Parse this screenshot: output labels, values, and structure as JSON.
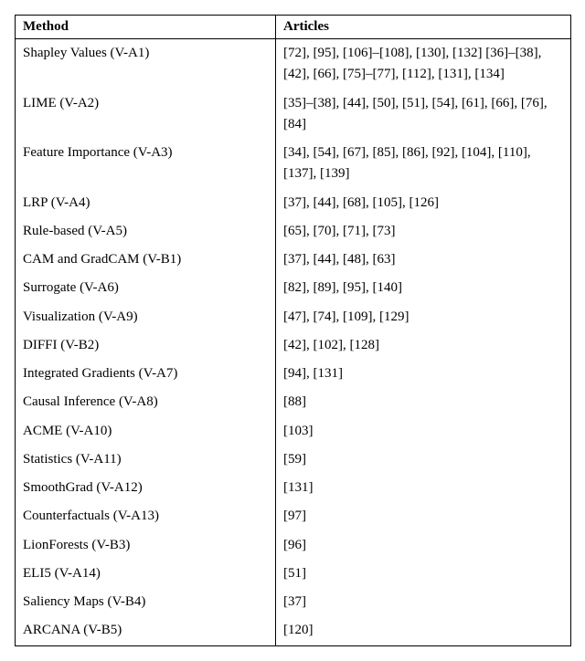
{
  "headers": {
    "method": "Method",
    "articles": "Articles"
  },
  "rows": [
    {
      "method": "Shapley Values (V-A1)",
      "articles": " [72], [95], [106]–[108], [130], [132] [36]–[38], [42], [66], [75]–[77], [112], [131], [134]"
    },
    {
      "method": "LIME (V-A2)",
      "articles": " [35]–[38], [44], [50], [51], [54], [61], [66], [76], [84]"
    },
    {
      "method": "Feature Importance (V-A3)",
      "articles": " [34], [54], [67], [85], [86], [92], [104], [110], [137], [139]"
    },
    {
      "method": "LRP (V-A4)",
      "articles": " [37], [44], [68], [105], [126]"
    },
    {
      "method": "Rule-based (V-A5)",
      "articles": "[65], [70], [71], [73]"
    },
    {
      "method": "CAM and GradCAM (V-B1)",
      "articles": " [37], [44], [48], [63]"
    },
    {
      "method": "Surrogate (V-A6)",
      "articles": " [82], [89], [95], [140]"
    },
    {
      "method": "Visualization (V-A9)",
      "articles": " [47], [74], [109], [129]"
    },
    {
      "method": "DIFFI (V-B2)",
      "articles": " [42], [102], [128]"
    },
    {
      "method": "Integrated Gradients (V-A7)",
      "articles": " [94], [131]"
    },
    {
      "method": "Causal Inference (V-A8)",
      "articles": "[88]"
    },
    {
      "method": "ACME (V-A10)",
      "articles": "[103]"
    },
    {
      "method": "Statistics (V-A11)",
      "articles": "[59]"
    },
    {
      "method": "SmoothGrad (V-A12)",
      "articles": "[131]"
    },
    {
      "method": "Counterfactuals (V-A13)",
      "articles": "[97]"
    },
    {
      "method": "LionForests (V-B3)",
      "articles": "[96]"
    },
    {
      "method": "ELI5 (V-A14)",
      "articles": "[51]"
    },
    {
      "method": "Saliency Maps (V-B4)",
      "articles": "[37]"
    },
    {
      "method": "ARCANA (V-B5)",
      "articles": "[120]"
    }
  ]
}
